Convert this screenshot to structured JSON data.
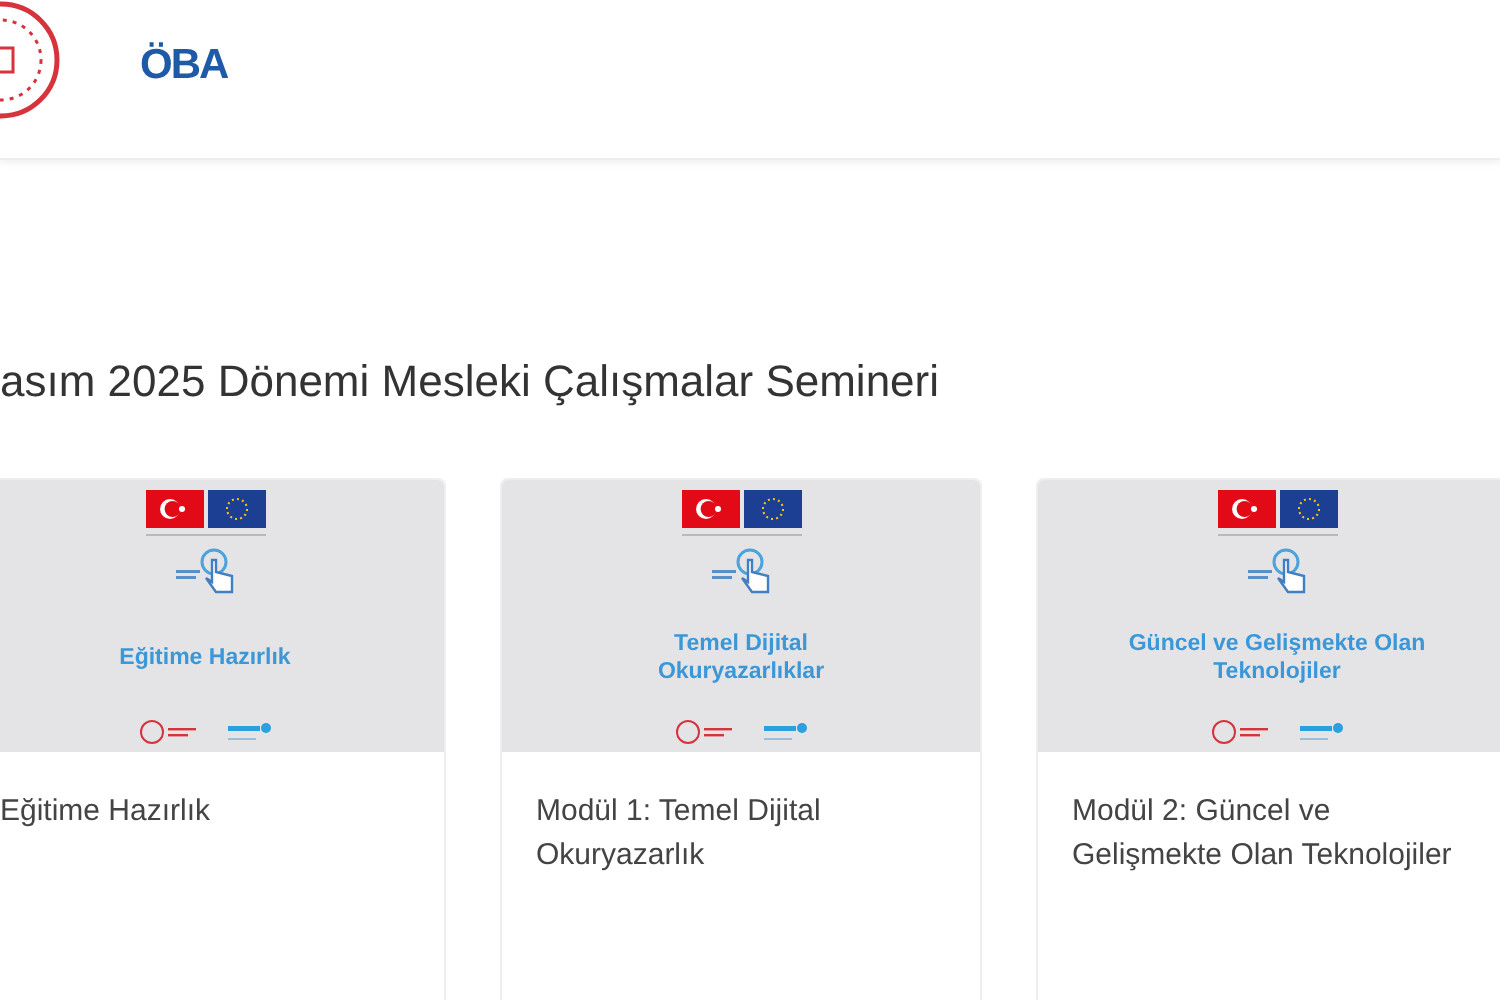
{
  "header": {
    "logo_text": "ÖBA"
  },
  "page_title": "asım 2025 Dönemi Mesleki Çalışmalar Semineri",
  "courses": [
    {
      "banner_title": "Eğitime Hazırlık",
      "title": "Eğitime Hazırlık"
    },
    {
      "banner_title": "Temel Dijital Okuryazarlıklar",
      "title": "Modül 1: Temel Dijital Okuryazarlık"
    },
    {
      "banner_title": "Güncel ve Gelişmekte Olan Teknolojiler",
      "title": "Modül 2: Güncel ve Gelişmekte Olan Teknolojiler"
    }
  ]
}
